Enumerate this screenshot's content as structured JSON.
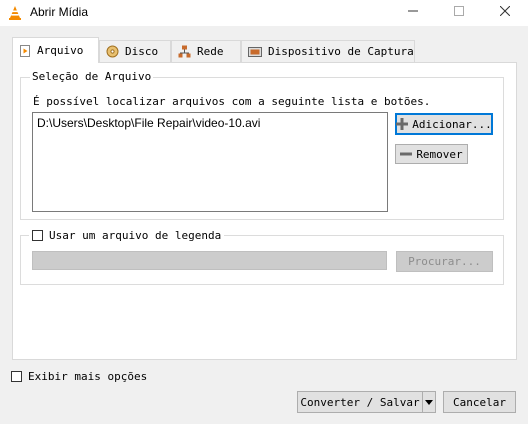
{
  "window": {
    "title": "Abrir Mídia",
    "minimize_icon": "minimize-icon",
    "maximize_icon": "maximize-icon",
    "close_icon": "close-icon"
  },
  "tabs": [
    {
      "label": "Arquivo",
      "icon": "file-play-icon",
      "active": true
    },
    {
      "label": "Disco",
      "icon": "disc-icon",
      "active": false
    },
    {
      "label": "Rede",
      "icon": "network-icon",
      "active": false
    },
    {
      "label": "Dispositivo de Captura",
      "icon": "capture-device-icon",
      "active": false
    }
  ],
  "file_selection": {
    "group_label": "Seleção de Arquivo",
    "description": "É possível localizar arquivos com a seguinte lista e botões.",
    "files": [
      "D:\\Users\\Desktop\\File Repair\\video-10.avi"
    ],
    "add_label": "Adicionar...",
    "remove_label": "Remover"
  },
  "subtitle": {
    "checkbox_label": "Usar um arquivo de legenda",
    "checked": false,
    "path_value": "",
    "browse_label": "Procurar..."
  },
  "footer": {
    "more_options_label": "Exibir mais opções",
    "convert_label": "Converter / Salvar",
    "cancel_label": "Cancelar"
  }
}
